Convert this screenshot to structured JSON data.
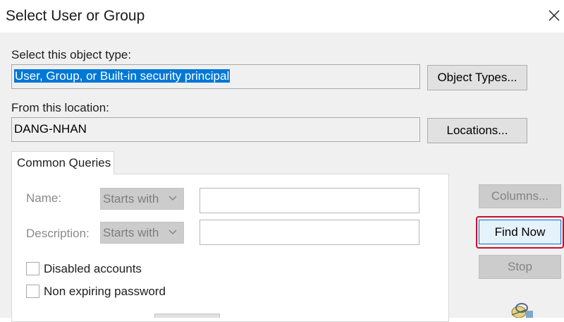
{
  "window": {
    "title": "Select User or Group"
  },
  "object_type": {
    "label": "Select this object type:",
    "value": "User, Group, or Built-in security principal",
    "button": "Object Types..."
  },
  "location": {
    "label": "From this location:",
    "value": "DANG-NHAN",
    "button": "Locations..."
  },
  "tab": {
    "label": "Common Queries"
  },
  "queries": {
    "name_label": "Name:",
    "name_mode": "Starts with",
    "name_value": "",
    "description_label": "Description:",
    "description_mode": "Starts with",
    "description_value": "",
    "disabled_accounts": "Disabled accounts",
    "non_expiring_password": "Non expiring password"
  },
  "buttons": {
    "columns": "Columns...",
    "find_now": "Find Now",
    "stop": "Stop"
  },
  "icons": {
    "close": "close-icon",
    "combo_arrow": "chevron-down-icon",
    "search_users": "search-users-icon"
  },
  "colors": {
    "selection": "#0078d7",
    "highlight_box": "#c8102e",
    "dialog_background": "#f0f0f0"
  }
}
